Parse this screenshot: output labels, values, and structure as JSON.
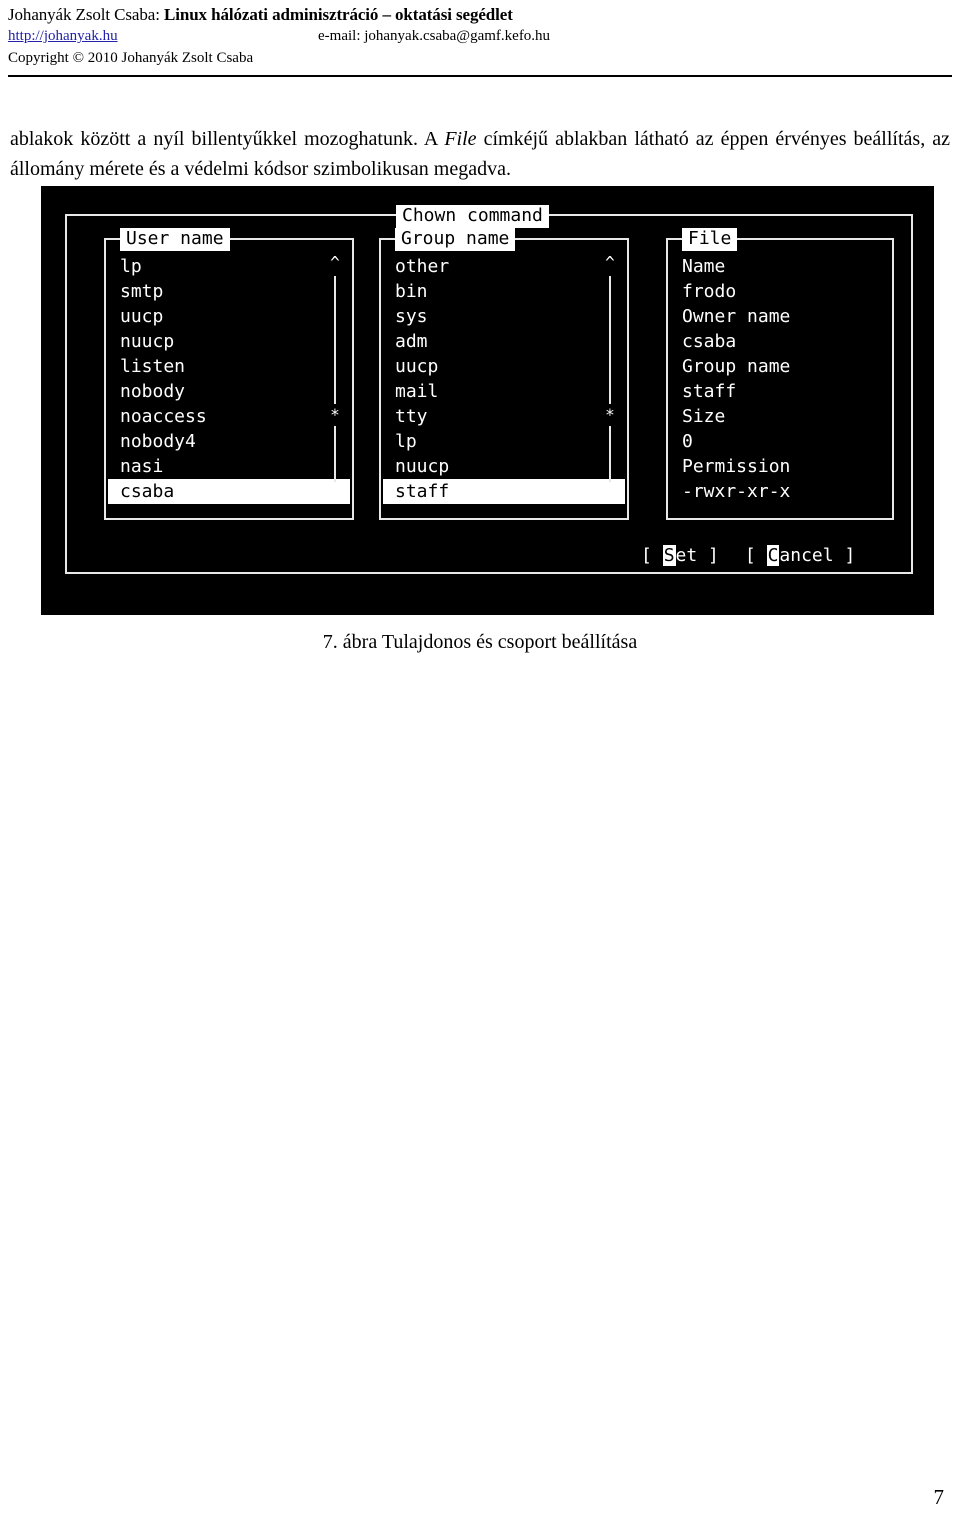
{
  "header": {
    "author_prefix": "Johanyák Zsolt Csaba: ",
    "work_title": "Linux hálózati adminisztráció – oktatási segédlet",
    "url": "http://johanyak.hu",
    "email": "e-mail: johanyak.csaba@gamf.kefo.hu",
    "copyright": "Copyright © 2010 Johanyák Zsolt Csaba"
  },
  "body": {
    "part1": "ablakok között a nyíl billentyűkkel mozoghatunk. A ",
    "emphasis": "File",
    "part2": " címkéjű ablakban látható az éppen érvényes beállítás, az állomány mérete és a védelmi kódsor szimbolikusan megadva."
  },
  "terminal": {
    "dialog_title": "Chown command",
    "panels": [
      {
        "id": "user-name",
        "title": "User name",
        "items": [
          "lp",
          "smtp",
          "uucp",
          "nuucp",
          "listen",
          "nobody",
          "noaccess",
          "nobody4",
          "nasi",
          "csaba"
        ],
        "selected_index": 9,
        "scrollbar": {
          "up": "^",
          "thumb": "*",
          "down": "+"
        }
      },
      {
        "id": "group-name",
        "title": "Group name",
        "items": [
          "other",
          "bin",
          "sys",
          "adm",
          "uucp",
          "mail",
          "tty",
          "lp",
          "nuucp",
          "staff"
        ],
        "selected_index": 9,
        "scrollbar": {
          "up": "^",
          "thumb": "*",
          "down": "+"
        }
      },
      {
        "id": "file",
        "title": "File",
        "items": [
          "Name",
          "frodo",
          "Owner name",
          "csaba",
          "Group name",
          "staff",
          "Size",
          "0",
          "Permission",
          "-rwxr-xr-x"
        ],
        "selected_index": -1
      }
    ],
    "buttons": [
      {
        "id": "set",
        "open": "[ ",
        "hotkey": "S",
        "rest": "et ",
        "close": "]"
      },
      {
        "id": "cancel",
        "open": "[ ",
        "hotkey": "C",
        "rest": "ancel ",
        "close": "]"
      }
    ]
  },
  "caption": "7. ábra Tulajdonos és csoport beállítása",
  "page_number": "7",
  "colors": {
    "link": "#2222aa",
    "terminal_bg": "#000000",
    "terminal_fg": "#ffffff"
  }
}
